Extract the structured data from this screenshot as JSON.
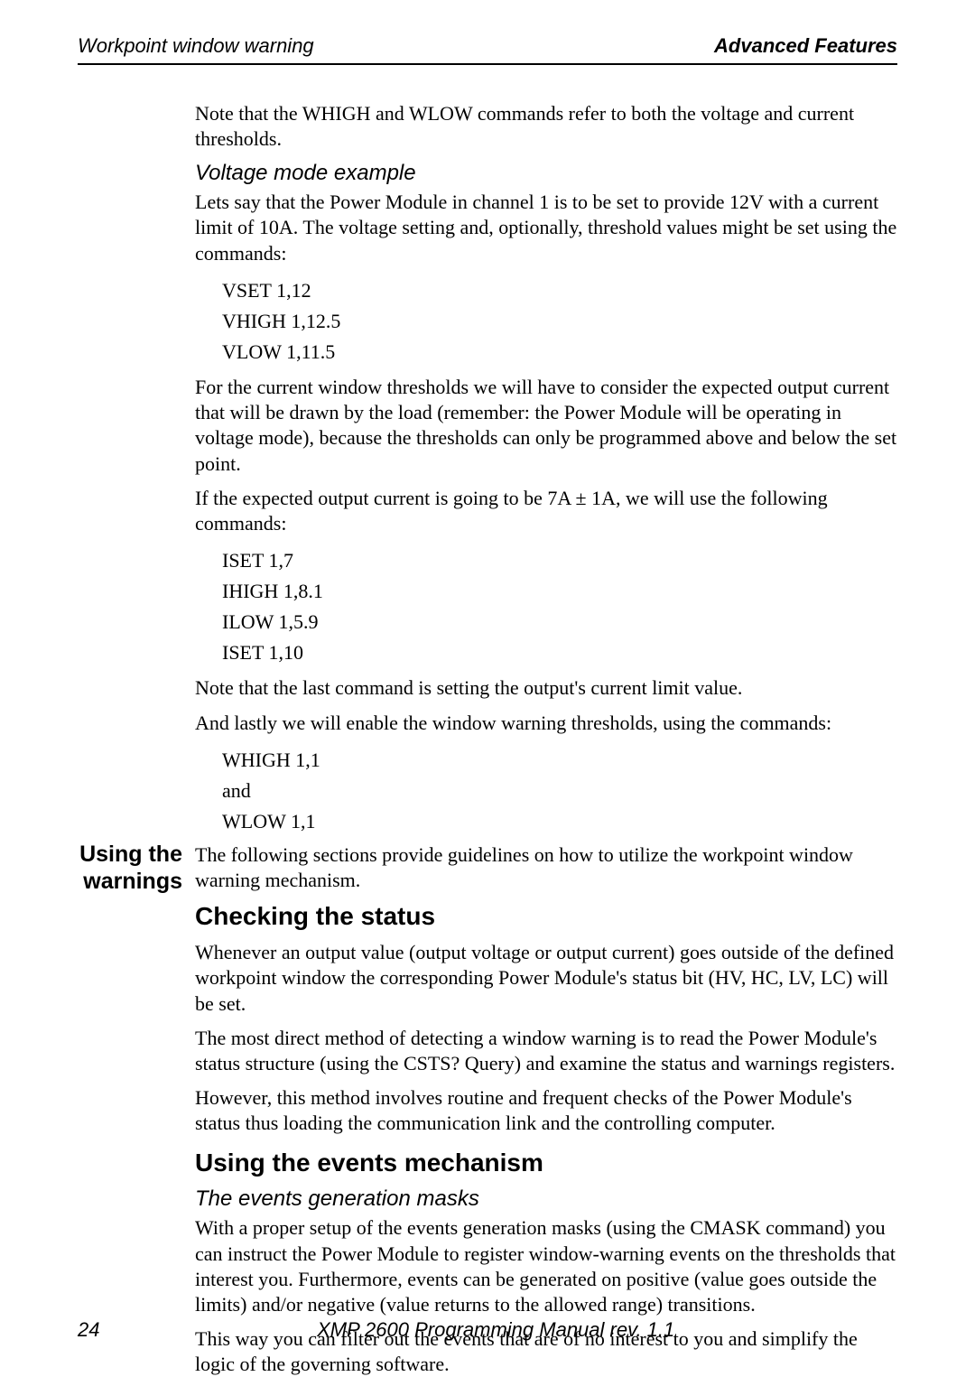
{
  "header": {
    "left": "Workpoint window warning",
    "right": "Advanced Features"
  },
  "intro_note": "Note that the WHIGH and WLOW commands refer to both the voltage and current thresholds.",
  "voltage_example": {
    "heading": "Voltage mode example",
    "p1": "Lets say that the Power Module in channel 1 is to be set to provide 12V with a current limit of 10A. The voltage setting and, optionally, threshold values might be set using the commands:",
    "cmds1": [
      "VSET 1,12",
      "VHIGH 1,12.5",
      "VLOW 1,11.5"
    ],
    "p2": "For the current window thresholds we will have to consider the expected output current that will be drawn by the load (remember: the Power Module will be operating in voltage mode), because the thresholds can only be programmed above and below the set point.",
    "p3": "If the expected output current is going to be 7A ± 1A, we will use the following commands:",
    "cmds2": [
      "ISET 1,7",
      "IHIGH 1,8.1",
      "ILOW 1,5.9",
      "ISET 1,10"
    ],
    "p4": "Note that the last command is setting the output's current limit value.",
    "p5": "And lastly we will enable the window warning thresholds, using the commands:",
    "cmds3": [
      "WHIGH 1,1",
      "and",
      "WLOW 1,1"
    ]
  },
  "using_warnings": {
    "side_label_line1": "Using the",
    "side_label_line2": "warnings",
    "intro": "The following sections provide guidelines on how to utilize the workpoint window warning mechanism.",
    "checking": {
      "heading": "Checking the status",
      "p1": "Whenever an output value (output voltage or output current) goes outside of the defined workpoint window the corresponding Power Module's status bit (HV, HC, LV, LC) will be set.",
      "p2": "The most direct method of detecting a window warning is to read the Power Module's status structure (using the CSTS? Query) and examine the status and warnings registers.",
      "p3": "However, this method involves routine and frequent checks of the Power Module's status thus loading the communication link and the controlling computer."
    },
    "events": {
      "heading": "Using the events mechanism",
      "subhead": "The events generation masks",
      "p1": "With a proper setup of the events generation masks (using the CMASK command) you can instruct the Power Module to register window-warning events on the thresholds that interest you. Furthermore, events can be generated on positive (value goes outside the limits) and/or negative (value returns to the allowed range) transitions.",
      "p2": "This way you can filter out the events that are of no interest to you and simplify the logic of the governing software."
    }
  },
  "footer": {
    "page": "24",
    "title": "XMP 2600 Programming Manual rev. 1.1"
  }
}
